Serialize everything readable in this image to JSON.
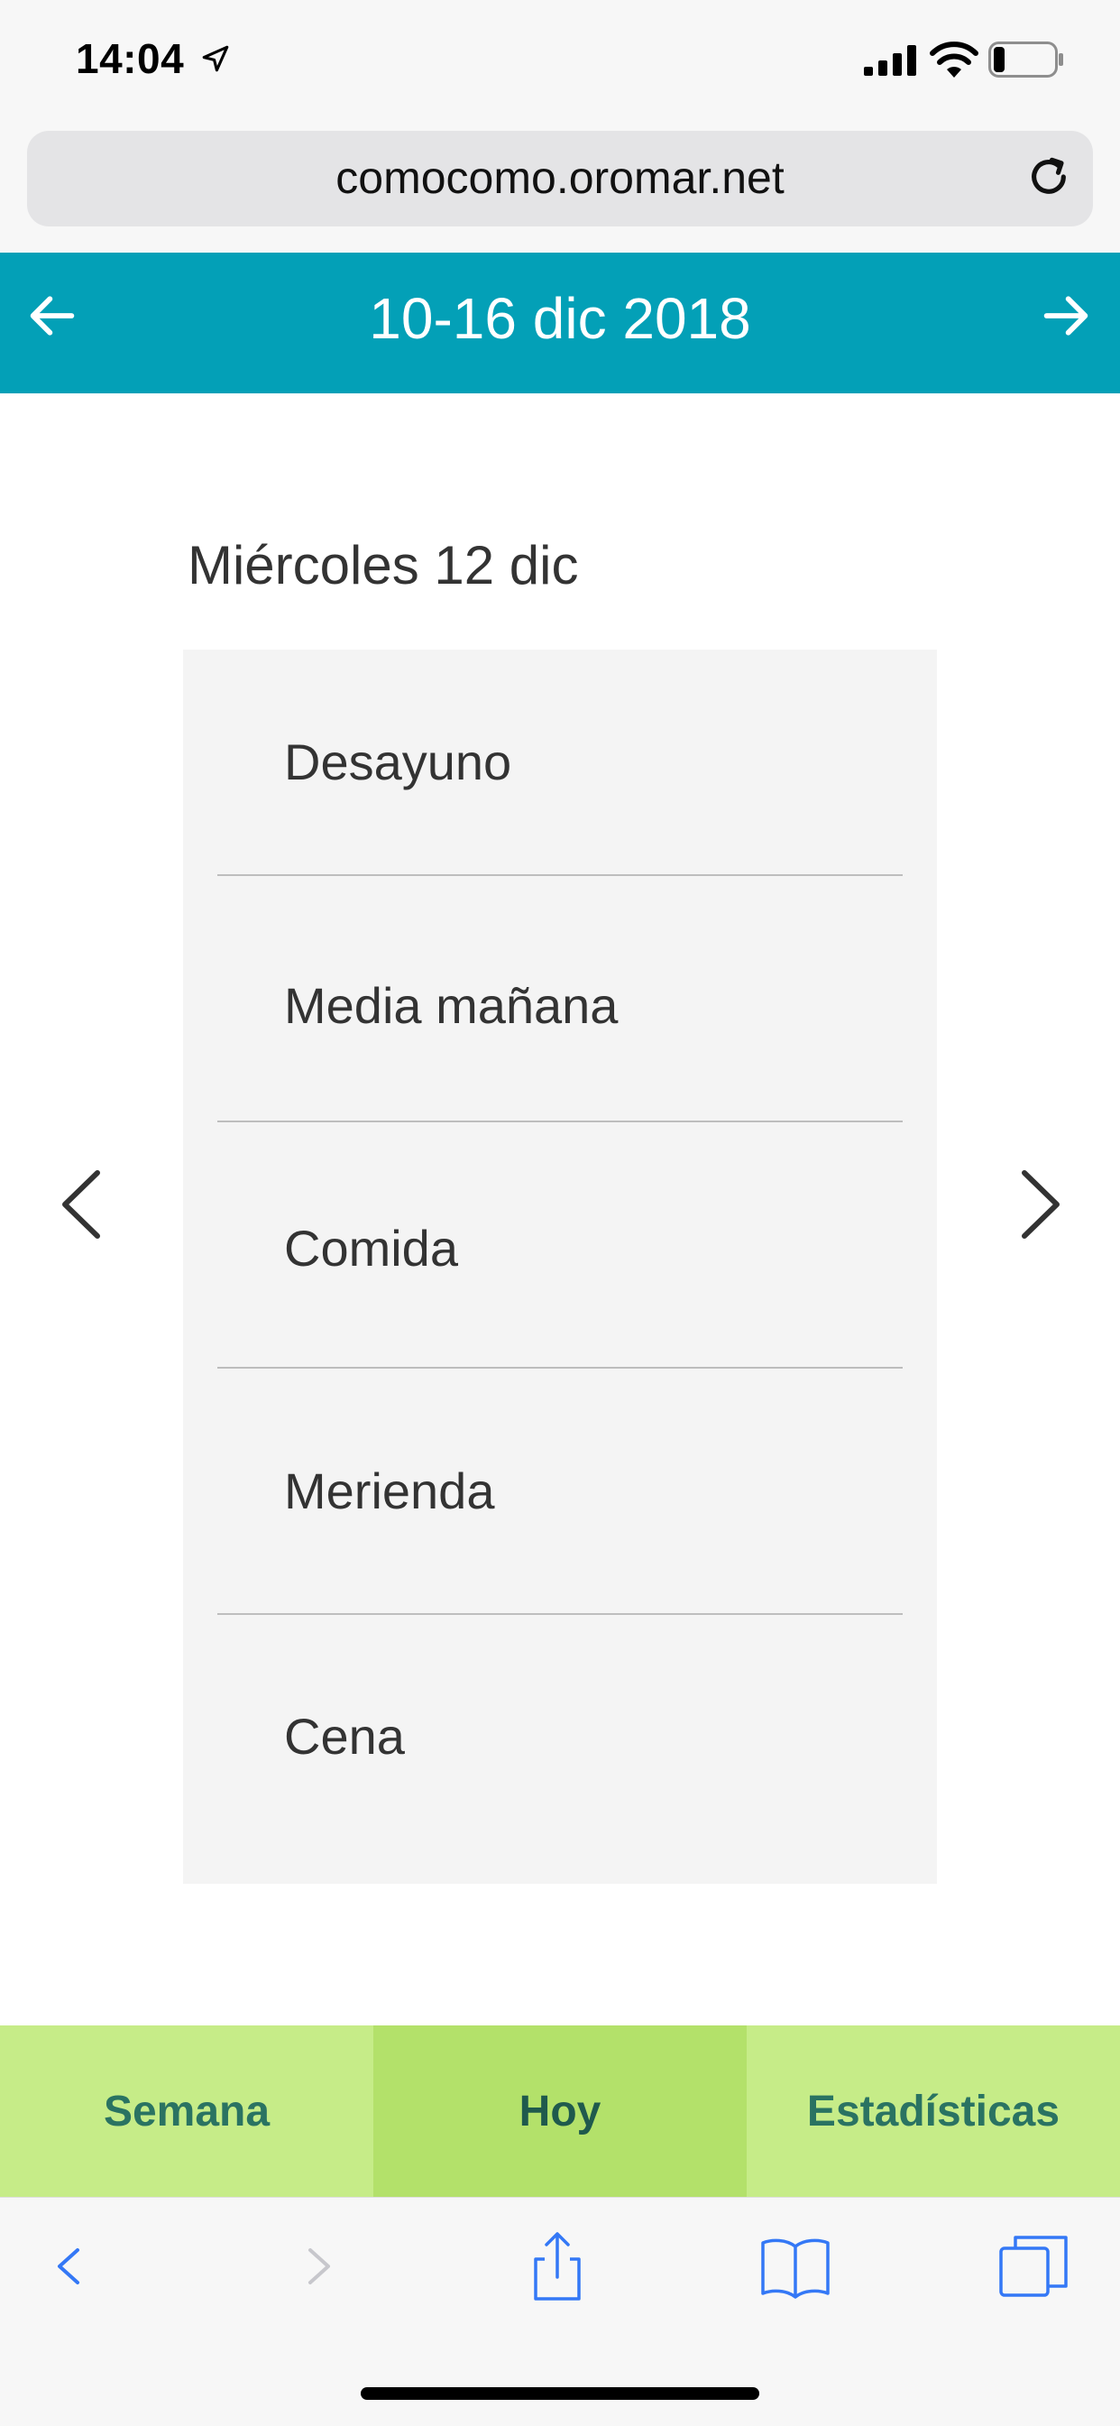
{
  "status_bar": {
    "time": "14:04"
  },
  "browser": {
    "url": "comocomo.oromar.net"
  },
  "header": {
    "title": "10-16 dic 2018"
  },
  "day": {
    "title": "Miércoles 12 dic",
    "meals": [
      {
        "label": "Desayuno"
      },
      {
        "label": "Media mañana"
      },
      {
        "label": "Comida"
      },
      {
        "label": "Merienda"
      },
      {
        "label": "Cena"
      }
    ]
  },
  "tabs": [
    {
      "label": "Semana"
    },
    {
      "label": "Hoy",
      "active": true
    },
    {
      "label": "Estadísticas"
    }
  ],
  "colors": {
    "header": "#03a0b7",
    "tab_bar": "#c6ec88",
    "tab_active": "#b3e16a",
    "tab_text": "#2a7362",
    "safari_blue": "#3478f6"
  },
  "icons": {
    "status": [
      "location-arrow-icon",
      "signal-icon",
      "wifi-icon",
      "battery-icon"
    ],
    "toolbar": [
      "back-icon",
      "forward-icon",
      "share-icon",
      "bookmarks-icon",
      "tabs-icon"
    ]
  }
}
